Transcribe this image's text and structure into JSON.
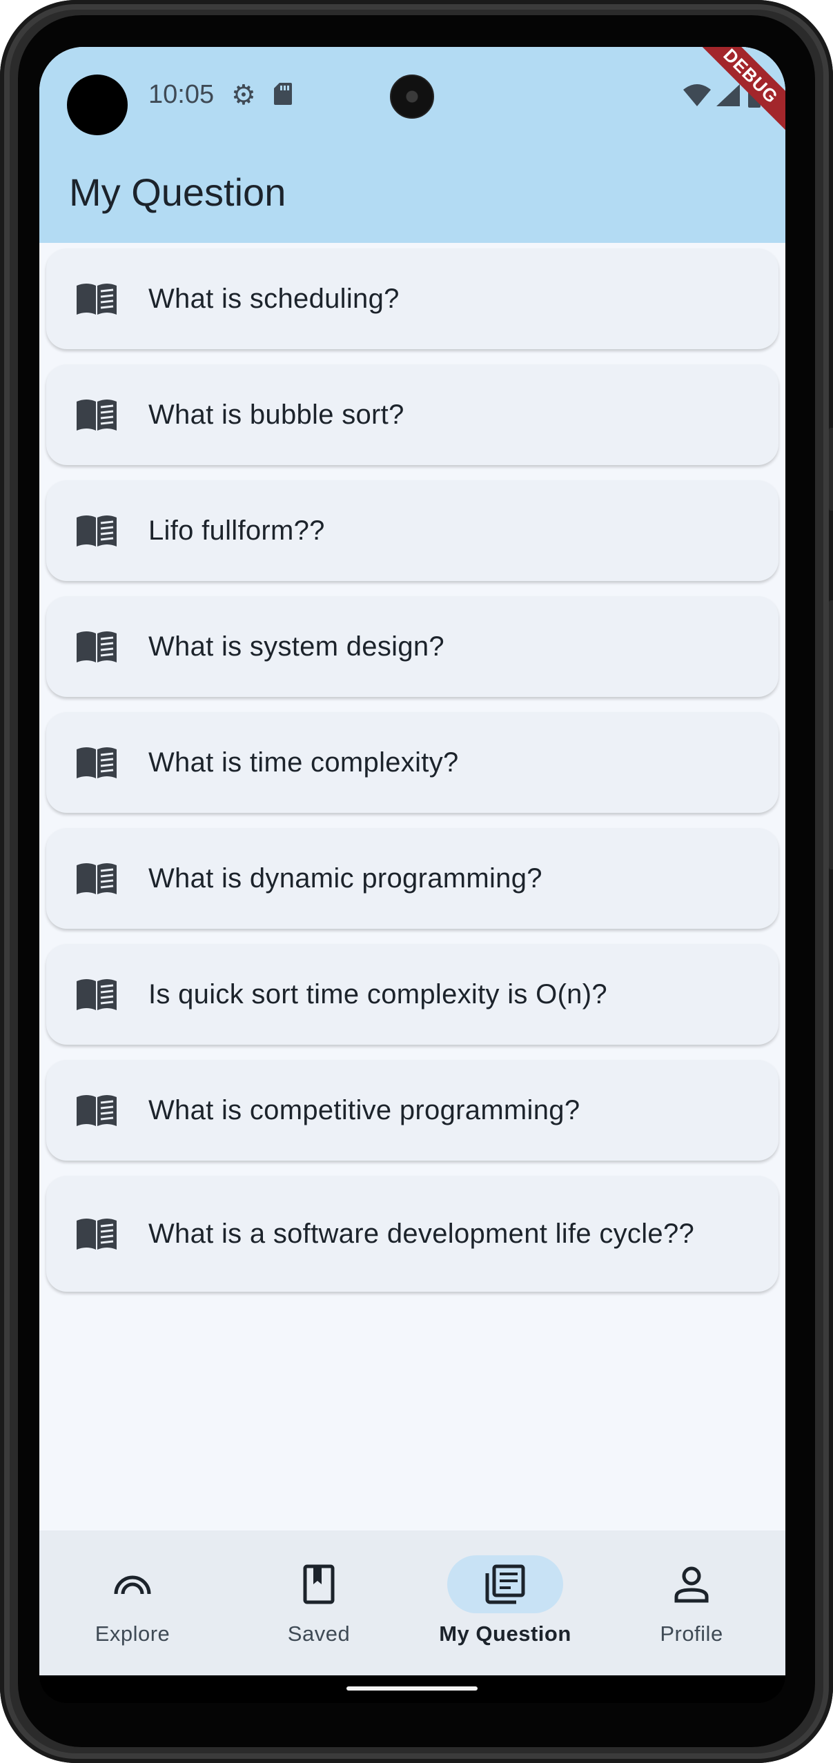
{
  "status_bar": {
    "time": "10:05",
    "debug_label": "DEBUG"
  },
  "app_bar": {
    "title": "My Question"
  },
  "questions": [
    {
      "text": "What is scheduling?",
      "icon": "book-icon"
    },
    {
      "text": "What is bubble sort?",
      "icon": "book-icon"
    },
    {
      "text": "Lifo fullform??",
      "icon": "book-icon"
    },
    {
      "text": "What is system design?",
      "icon": "book-icon"
    },
    {
      "text": "What is time complexity?",
      "icon": "book-icon"
    },
    {
      "text": "What is dynamic programming?",
      "icon": "book-icon"
    },
    {
      "text": "Is quick sort time complexity is O(n)?",
      "icon": "book-icon"
    },
    {
      "text": "What is competitive programming?",
      "icon": "book-icon"
    },
    {
      "text": "What is a software development life cycle??",
      "icon": "book-icon"
    }
  ],
  "bottom_nav": {
    "items": [
      {
        "label": "Explore",
        "icon": "explore-arc-icon",
        "active": false
      },
      {
        "label": "Saved",
        "icon": "bookmark-icon",
        "active": false
      },
      {
        "label": "My Question",
        "icon": "question-list-icon",
        "active": true
      },
      {
        "label": "Profile",
        "icon": "person-icon",
        "active": false
      }
    ]
  },
  "colors": {
    "app_bar_bg": "#b3dbf3",
    "card_bg": "#edf1f7",
    "nav_bg": "#e7ecf2",
    "active_pill": "#c8e2f5",
    "debug_ribbon": "#a3262b"
  }
}
